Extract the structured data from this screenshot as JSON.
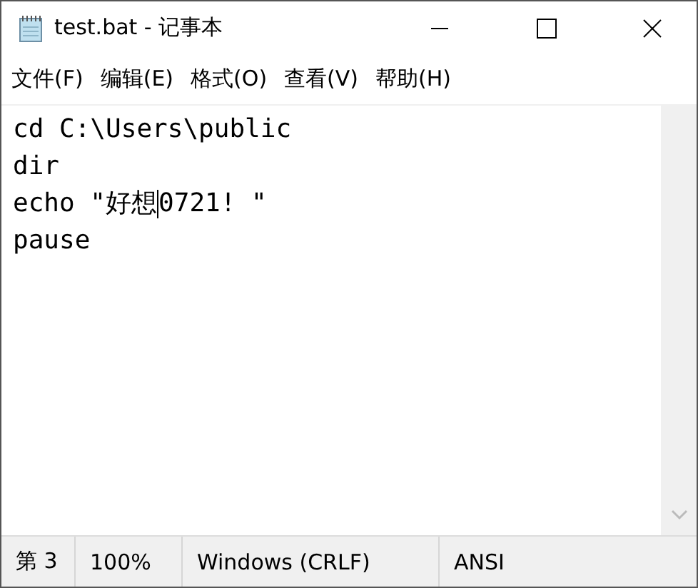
{
  "window": {
    "title": "test.bat - 记事本"
  },
  "menu": [
    "文件(F)",
    "编辑(E)",
    "格式(O)",
    "查看(V)",
    "帮助(H)"
  ],
  "editor": {
    "lines": [
      {
        "text": "cd C:\\Users\\public"
      },
      {
        "text": "dir"
      },
      {
        "text": "echo \"好想",
        "caret": true,
        "text_after_caret": "0721! \""
      },
      {
        "text": "pause"
      }
    ]
  },
  "status_bar": [
    "第 3",
    "100%",
    "Windows (CRLF)",
    "ANSI"
  ]
}
